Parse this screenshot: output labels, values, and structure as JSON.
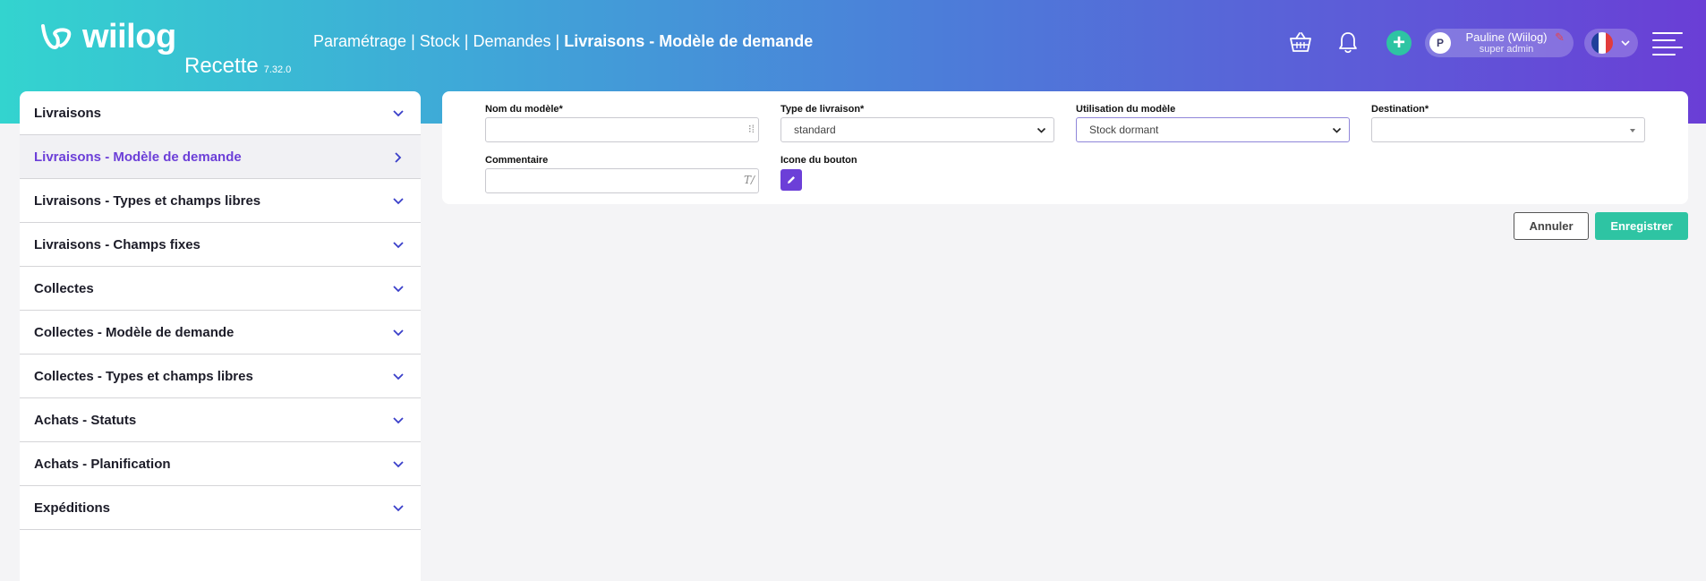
{
  "app": {
    "logo_text": "wiilog",
    "environment": "Recette",
    "version": "7.32.0"
  },
  "breadcrumb": {
    "items": [
      "Paramétrage",
      "Stock",
      "Demandes"
    ],
    "current": "Livraisons - Modèle de demande",
    "separator": "|"
  },
  "header": {
    "icons": [
      "basket-icon",
      "bell-icon",
      "plus-icon",
      "hamburger-menu-icon"
    ],
    "user": {
      "initial": "P",
      "name": "Pauline (Wiilog)",
      "role": "super admin"
    },
    "language": "fr"
  },
  "sidebar": {
    "items": [
      {
        "label": "Livraisons",
        "icon": "chevron-down-icon"
      },
      {
        "label": "Livraisons - Modèle de demande",
        "icon": "chevron-right-icon",
        "active": true
      },
      {
        "label": "Livraisons - Types et champs libres",
        "icon": "chevron-down-icon"
      },
      {
        "label": "Livraisons - Champs fixes",
        "icon": "chevron-down-icon"
      },
      {
        "label": "Collectes",
        "icon": "chevron-down-icon"
      },
      {
        "label": "Collectes - Modèle de demande",
        "icon": "chevron-down-icon"
      },
      {
        "label": "Collectes - Types et champs libres",
        "icon": "chevron-down-icon"
      },
      {
        "label": "Achats - Statuts",
        "icon": "chevron-down-icon"
      },
      {
        "label": "Achats - Planification",
        "icon": "chevron-down-icon"
      },
      {
        "label": "Expéditions",
        "icon": "chevron-down-icon"
      }
    ]
  },
  "form": {
    "model_name": {
      "label": "Nom du modèle*",
      "value": ""
    },
    "delivery_type": {
      "label": "Type de livraison*",
      "value": "standard"
    },
    "model_usage": {
      "label": "Utilisation du modèle",
      "value": "Stock dormant"
    },
    "destination": {
      "label": "Destination*",
      "value": ""
    },
    "comment": {
      "label": "Commentaire",
      "value": ""
    },
    "button_icon": {
      "label": "Icone du bouton"
    }
  },
  "actions": {
    "cancel_label": "Annuler",
    "save_label": "Enregistrer"
  },
  "colors": {
    "accent": "#6c3fd8",
    "success": "#2ec4a3",
    "header_gradient_start": "#33d4cf",
    "header_gradient_end": "#6a3ed6"
  }
}
